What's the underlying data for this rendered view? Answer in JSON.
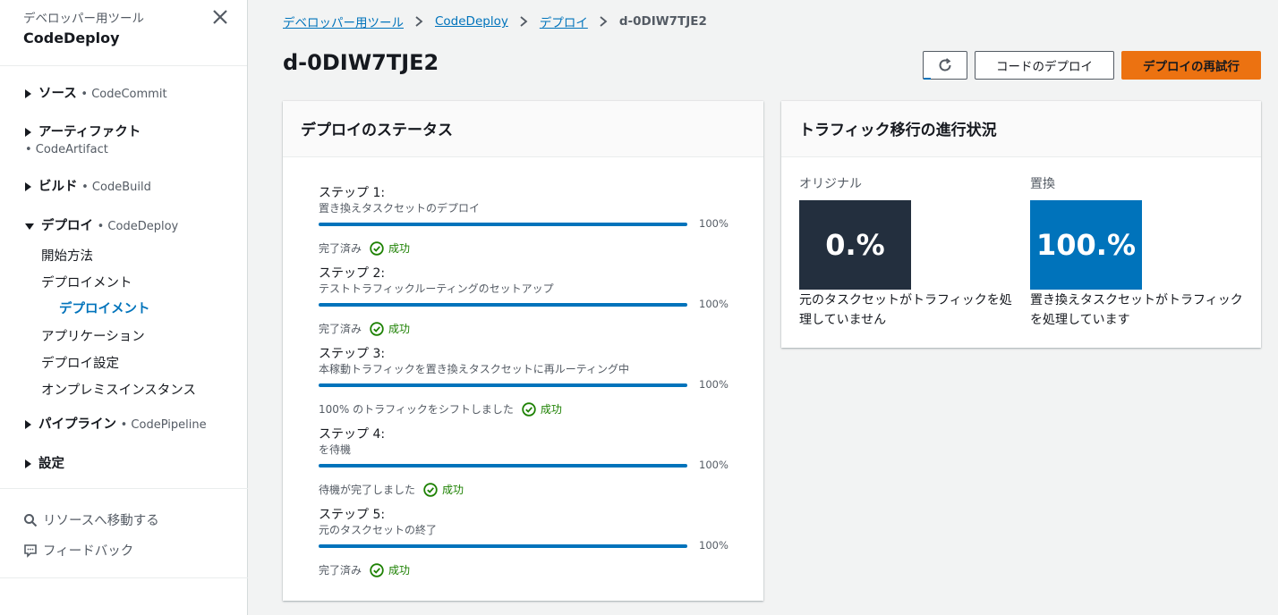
{
  "sidebar": {
    "subtitle": "デベロッパー用ツール",
    "title": "CodeDeploy",
    "groups": [
      {
        "label": "ソース",
        "service": "• CodeCommit"
      },
      {
        "label": "アーティファクト",
        "service": "• CodeArtifact"
      },
      {
        "label": "ビルド",
        "service": "• CodeBuild"
      },
      {
        "label": "デプロイ",
        "service": "• CodeDeploy"
      },
      {
        "label": "パイプライン",
        "service": "• CodePipeline"
      },
      {
        "label": "設定",
        "service": ""
      }
    ],
    "deploy_items": [
      "開始方法",
      "デプロイメント",
      "デプロイメント",
      "アプリケーション",
      "デプロイ設定",
      "オンプレミスインスタンス"
    ],
    "footer": {
      "goto": "リソースへ移動する",
      "feedback": "フィードバック"
    }
  },
  "breadcrumb": [
    "デベロッパー用ツール",
    "CodeDeploy",
    "デプロイ",
    "d-0DIW7TJE2"
  ],
  "page_title": "d-0DIW7TJE2",
  "buttons": {
    "deploy_code": "コードのデプロイ",
    "retry": "デプロイの再試行"
  },
  "status_panel": {
    "title": "デプロイのステータス",
    "steps": [
      {
        "title": "ステップ 1:",
        "desc": "置き換えタスクセットのデプロイ",
        "progress": 100,
        "pct": "100%",
        "status": "完了済み",
        "result": "成功"
      },
      {
        "title": "ステップ 2:",
        "desc": "テストトラフィックルーティングのセットアップ",
        "progress": 100,
        "pct": "100%",
        "status": "完了済み",
        "result": "成功"
      },
      {
        "title": "ステップ 3:",
        "desc": "本稼動トラフィックを置き換えタスクセットに再ルーティング中",
        "progress": 100,
        "pct": "100%",
        "status": "100% のトラフィックをシフトしました",
        "result": "成功"
      },
      {
        "title": "ステップ 4:",
        "desc": "を待機",
        "progress": 100,
        "pct": "100%",
        "status": "待機が完了しました",
        "result": "成功"
      },
      {
        "title": "ステップ 5:",
        "desc": "元のタスクセットの終了",
        "progress": 100,
        "pct": "100%",
        "status": "完了済み",
        "result": "成功"
      }
    ]
  },
  "traffic_panel": {
    "title": "トラフィック移行の進行状況",
    "original": {
      "label": "オリジナル",
      "value": "0.%",
      "desc": "元のタスクセットがトラフィックを処理していません",
      "color": "#232f3e"
    },
    "replacement": {
      "label": "置換",
      "value": "100.%",
      "desc": "置き換えタスクセットがトラフィックを処理しています",
      "color": "#0073bb"
    }
  },
  "colors": {
    "accent": "#0073bb",
    "primary_button": "#ec7211",
    "success": "#1d8102"
  }
}
